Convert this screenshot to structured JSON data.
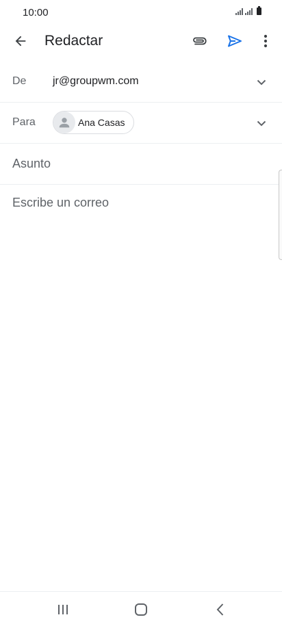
{
  "status_bar": {
    "time": "10:00"
  },
  "app_bar": {
    "title": "Redactar"
  },
  "from": {
    "label": "De",
    "value": "jr@groupwm.com"
  },
  "to": {
    "label": "Para",
    "recipient": "Ana Casas"
  },
  "subject": {
    "placeholder": "Asunto"
  },
  "body": {
    "placeholder": "Escribe un correo"
  },
  "colors": {
    "accent": "#1a73e8",
    "text": "#202124",
    "secondary": "#5f6368"
  },
  "icons": {
    "back": "arrow-left-icon",
    "attach": "paperclip-icon",
    "send": "send-icon",
    "more": "more-vert-icon",
    "chevron": "chevron-down-icon",
    "avatar": "person-icon"
  }
}
